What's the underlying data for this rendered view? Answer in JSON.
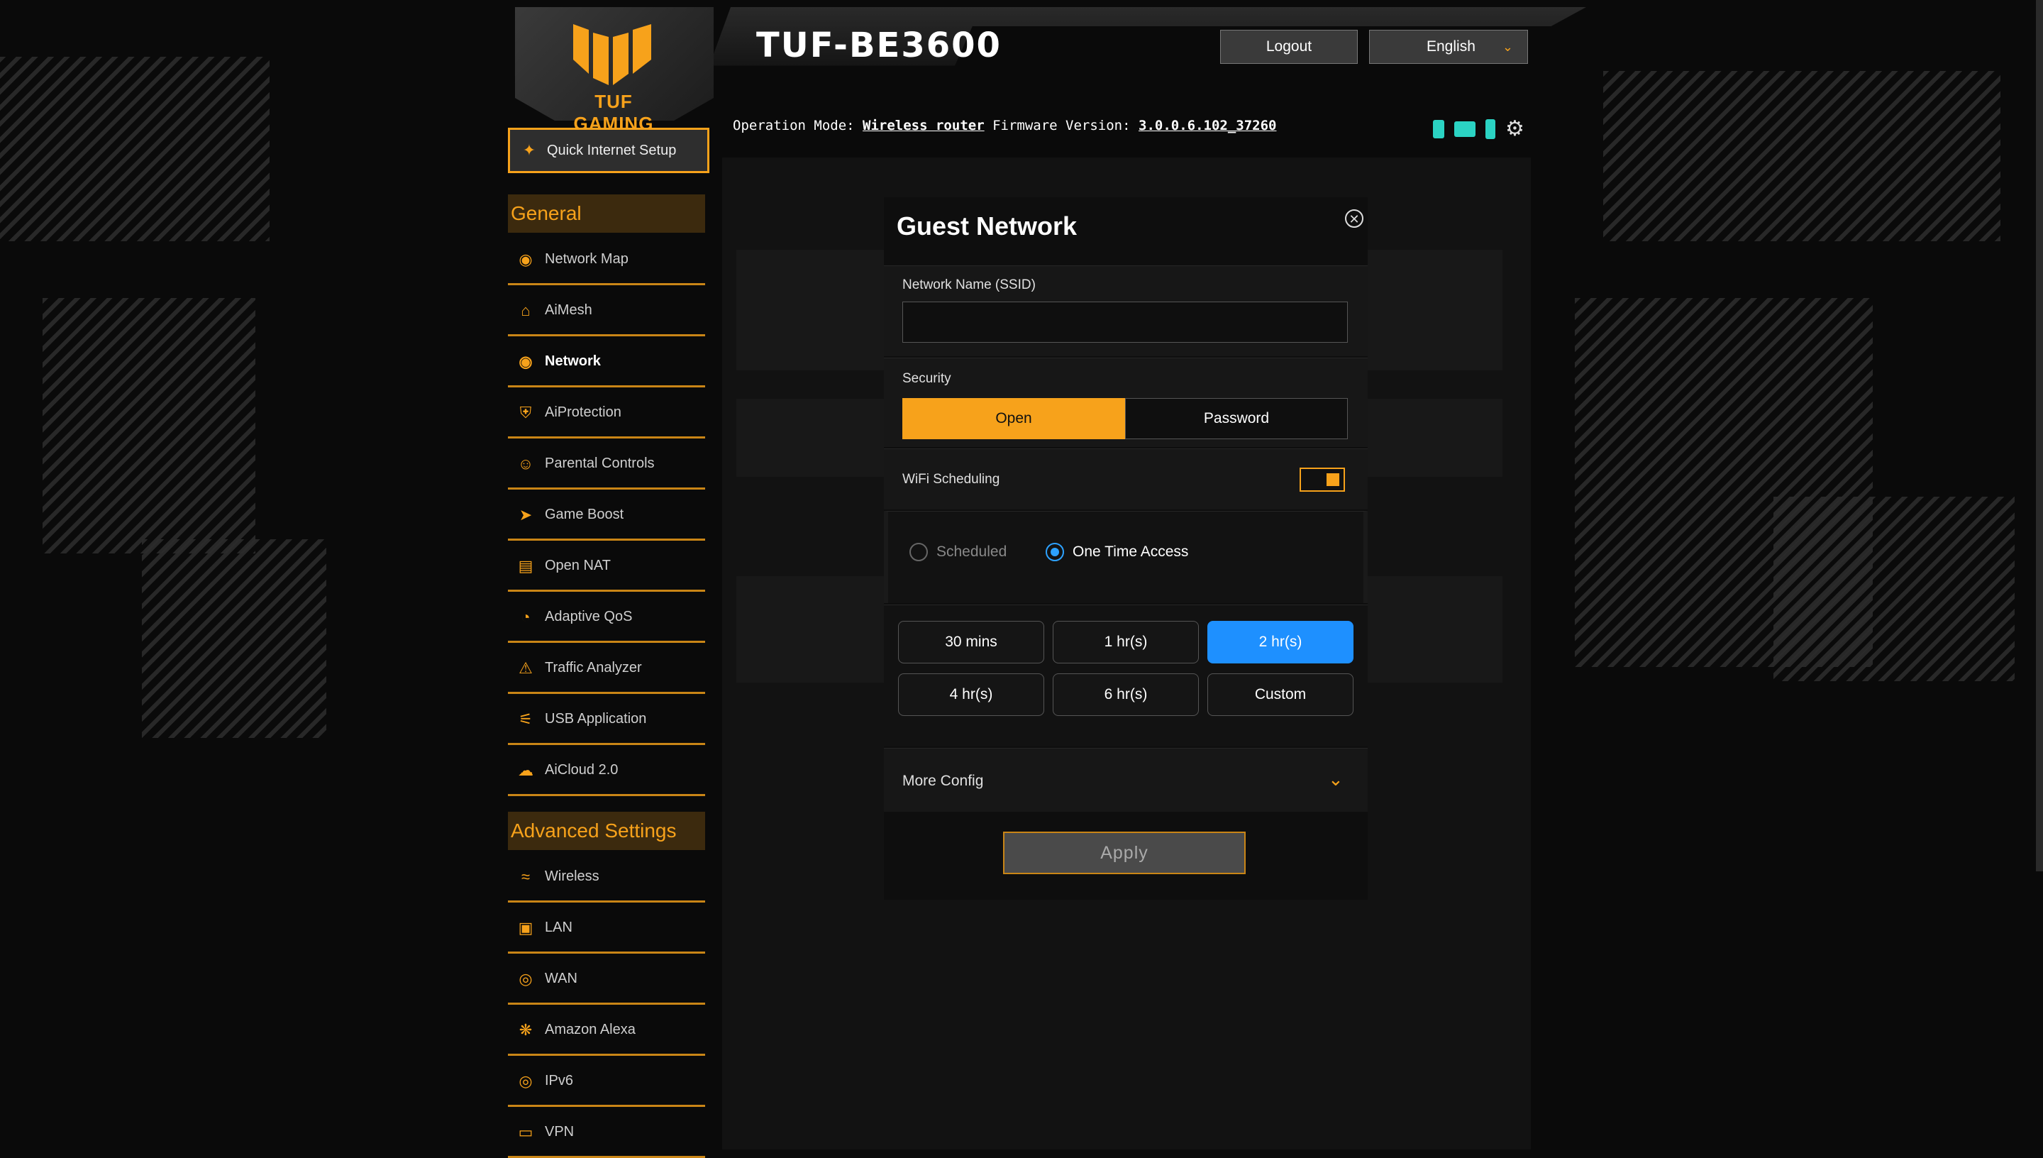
{
  "header": {
    "brand": "TUF GAMING",
    "model": "TUF-BE3600",
    "logout_label": "Logout",
    "language": "English",
    "operation_mode_label": "Operation Mode:",
    "operation_mode_value": "Wireless router",
    "firmware_label": "Firmware Version:",
    "firmware_value": "3.0.0.6.102_37260"
  },
  "sidebar": {
    "quick_setup": "Quick Internet Setup",
    "general_title": "General",
    "general_items": [
      {
        "label": "Network Map",
        "icon": "network-map-icon"
      },
      {
        "label": "AiMesh",
        "icon": "aimesh-icon"
      },
      {
        "label": "Network",
        "icon": "network-icon"
      },
      {
        "label": "AiProtection",
        "icon": "shield-icon"
      },
      {
        "label": "Parental Controls",
        "icon": "parental-icon"
      },
      {
        "label": "Game Boost",
        "icon": "rocket-icon"
      },
      {
        "label": "Open NAT",
        "icon": "nat-icon"
      },
      {
        "label": "Adaptive QoS",
        "icon": "gauge-icon"
      },
      {
        "label": "Traffic Analyzer",
        "icon": "traffic-icon"
      },
      {
        "label": "USB Application",
        "icon": "usb-icon"
      },
      {
        "label": "AiCloud 2.0",
        "icon": "cloud-icon"
      }
    ],
    "advanced_title": "Advanced Settings",
    "advanced_items": [
      {
        "label": "Wireless",
        "icon": "wifi-icon"
      },
      {
        "label": "LAN",
        "icon": "lan-icon"
      },
      {
        "label": "WAN",
        "icon": "globe-icon"
      },
      {
        "label": "Amazon Alexa",
        "icon": "alexa-icon"
      },
      {
        "label": "IPv6",
        "icon": "ipv6-icon"
      },
      {
        "label": "VPN",
        "icon": "vpn-icon"
      }
    ]
  },
  "modal": {
    "title": "Guest Network",
    "ssid_label": "Network Name (SSID)",
    "ssid_value": "",
    "security_label": "Security",
    "security_options": [
      "Open",
      "Password"
    ],
    "security_selected": "Open",
    "scheduling_label": "WiFi Scheduling",
    "schedule_options": [
      "Scheduled",
      "One Time Access"
    ],
    "schedule_selected": "One Time Access",
    "durations": [
      "30 mins",
      "1 hr(s)",
      "2 hr(s)",
      "4 hr(s)",
      "6 hr(s)",
      "Custom"
    ],
    "duration_selected": "2 hr(s)",
    "more_config": "More Config",
    "apply": "Apply"
  },
  "colors": {
    "accent": "#f7a21b",
    "selected_blue": "#1e90ff"
  }
}
